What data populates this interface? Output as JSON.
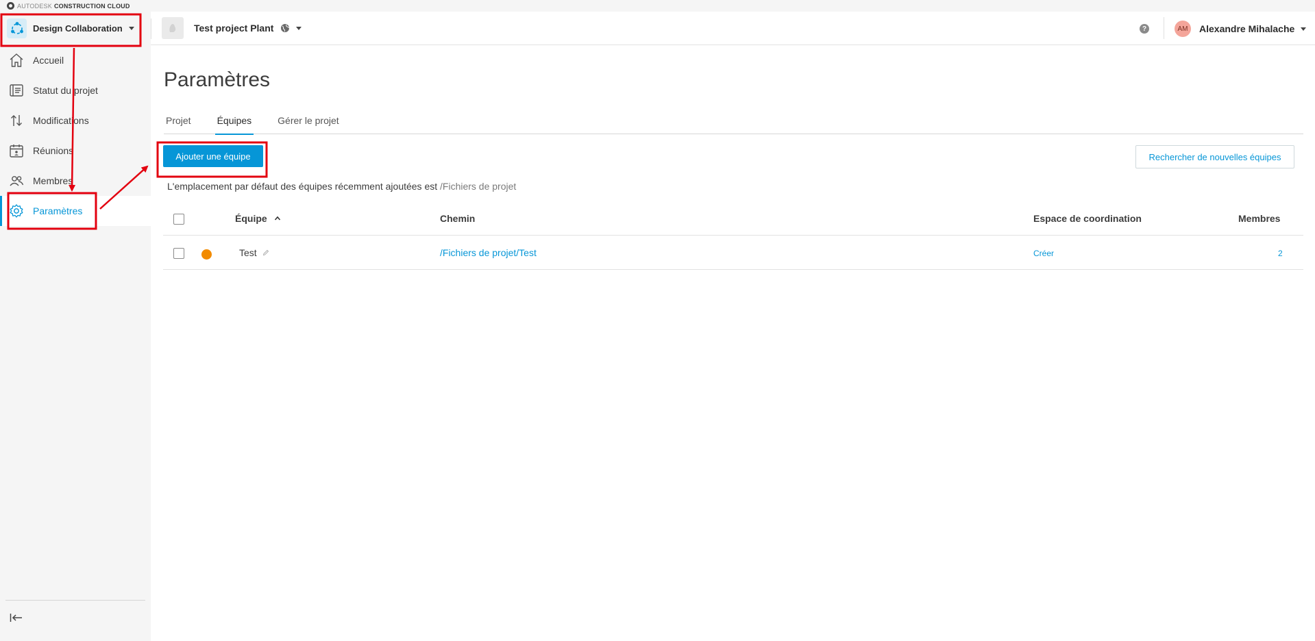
{
  "brand": {
    "company": "AUTODESK",
    "product": "CONSTRUCTION CLOUD"
  },
  "sidebar": {
    "module_label": "Design Collaboration",
    "items": [
      {
        "label": "Accueil",
        "icon": "home-icon"
      },
      {
        "label": "Statut du projet",
        "icon": "project-status-icon"
      },
      {
        "label": "Modifications",
        "icon": "changes-arrows-icon"
      },
      {
        "label": "Réunions",
        "icon": "calendar-meeting-icon"
      },
      {
        "label": "Membres",
        "icon": "members-icon"
      },
      {
        "label": "Paramètres",
        "icon": "gear-icon"
      }
    ],
    "active_index": 5
  },
  "header": {
    "project_name": "Test project Plant",
    "help_glyph": "?",
    "user_initials": "AM",
    "user_name": "Alexandre Mihalache"
  },
  "main": {
    "title": "Paramètres",
    "tabs": [
      {
        "label": "Projet"
      },
      {
        "label": "Équipes"
      },
      {
        "label": "Gérer le projet"
      }
    ],
    "active_tab": 1,
    "add_team_label": "Ajouter une équipe",
    "search_teams_label": "Rechercher de nouvelles équipes",
    "default_location_text": "L'emplacement par défaut des équipes récemment ajoutées est ",
    "default_location_path": "/Fichiers de projet"
  },
  "table": {
    "columns": {
      "team": "Équipe",
      "path": "Chemin",
      "coordination": "Espace de coordination",
      "members": "Membres"
    },
    "rows": [
      {
        "team": "Test",
        "color": "#f28b00",
        "path": "/Fichiers de projet/Test",
        "coordination": "Créer",
        "members": "2"
      }
    ]
  },
  "colors": {
    "accent": "#0696d7",
    "annotation": "#e3000f",
    "team_dot": "#f28b00"
  }
}
